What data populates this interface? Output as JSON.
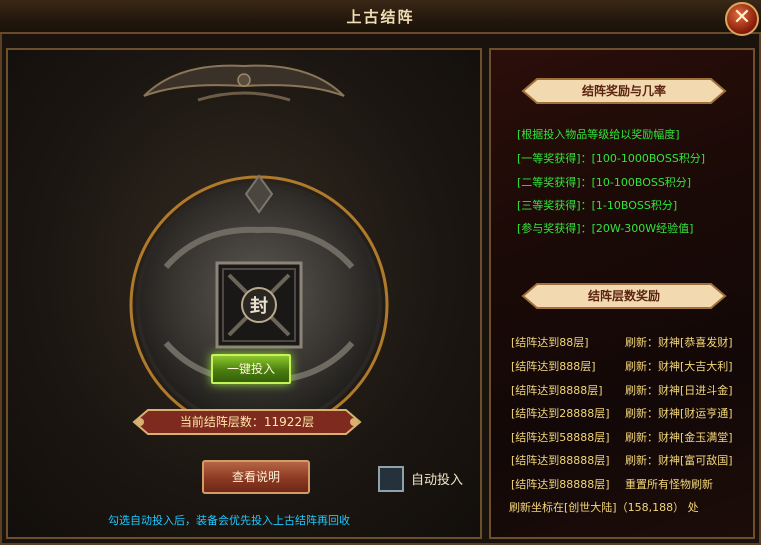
{
  "window": {
    "title": "上古结阵",
    "close_symbol": "✕"
  },
  "main": {
    "seal_char": "封",
    "invest_button": "一键投入",
    "level_text": "当前结阵层数：11922层",
    "info_button": "查看说明",
    "auto_label": "自动投入",
    "auto_checked": false,
    "tip": "勾选自动投入后，装备会优先投入上古结阵再回收"
  },
  "rewards": {
    "title": "结阵奖励与几率",
    "lines": [
      "[根据投入物品等级给以奖励幅度]",
      "[一等奖获得]：[100-1000BOSS积分]",
      "[二等奖获得]：[10-100BOSS积分]",
      "[三等奖获得]：[1-10BOSS积分]",
      "[参与奖获得]：[20W-300W经验值]"
    ]
  },
  "layers": {
    "title": "结阵层数奖励",
    "rows": [
      {
        "left": "[结阵达到88层]",
        "right": "刷新：财神[恭喜发财]"
      },
      {
        "left": "[结阵达到888层]",
        "right": "刷新：财神[大吉大利]"
      },
      {
        "left": "[结阵达到8888层]",
        "right": "刷新：财神[日进斗金]"
      },
      {
        "left": "[结阵达到28888层]",
        "right": "刷新：财神[财运亨通]"
      },
      {
        "left": "[结阵达到58888层]",
        "right": "刷新：财神[金玉满堂]"
      },
      {
        "left": "[结阵达到88888层]",
        "right": "刷新：财神[富可敌国]"
      },
      {
        "left": "[结阵达到88888层]",
        "right": "重置所有怪物刷新"
      }
    ],
    "coords": "刷新坐标在[创世大陆]（158,188） 处"
  },
  "colors": {
    "accent_gold": "#f3d67a",
    "reward_green": "#32e43c",
    "tip_blue": "#1ec8ff"
  }
}
